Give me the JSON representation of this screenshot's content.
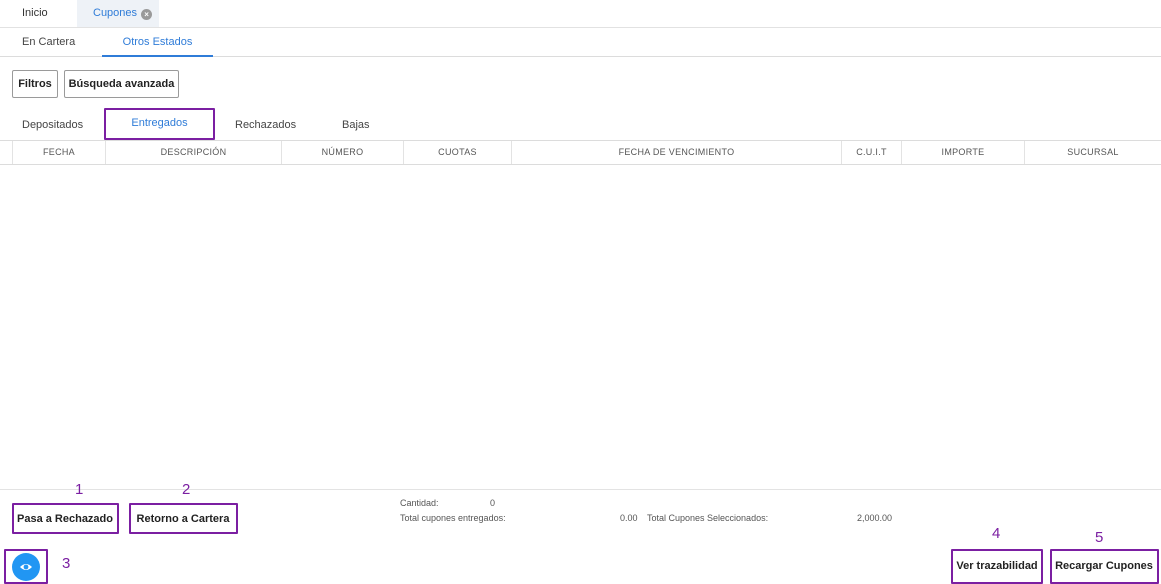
{
  "top_tabs": {
    "inicio": "Inicio",
    "cupones": "Cupones"
  },
  "second_tabs": {
    "en_cartera": "En Cartera",
    "otros_estados": "Otros Estados"
  },
  "toolbar": {
    "filtros": "Filtros",
    "busqueda_avanzada": "Búsqueda avanzada"
  },
  "sub_tabs": {
    "depositados": "Depositados",
    "entregados": "Entregados",
    "rechazados": "Rechazados",
    "bajas": "Bajas"
  },
  "table": {
    "columns": [
      "FECHA",
      "DESCRIPCIÓN",
      "NÚMERO",
      "CUOTAS",
      "FECHA DE VENCIMIENTO",
      "C.U.I.T",
      "IMPORTE",
      "SUCURSAL"
    ],
    "rows": []
  },
  "summary": {
    "cantidad_label": "Cantidad:",
    "cantidad_value": "0",
    "total_entregados_label": "Total cupones entregados:",
    "total_entregados_value": "0.00",
    "total_seleccionados_label": "Total Cupones Seleccionados:",
    "total_seleccionados_value": "2,000.00"
  },
  "actions": {
    "pasa_rechazado": "Pasa a Rechazado",
    "retorno_cartera": "Retorno a Cartera",
    "ver_trazabilidad": "Ver trazabilidad",
    "recargar_cupones": "Recargar Cupones"
  },
  "annotations": [
    "1",
    "2",
    "3",
    "4",
    "5"
  ],
  "colors": {
    "accent": "#2f7cd8",
    "highlight": "#7b1fa2",
    "fab": "#2196f3"
  }
}
